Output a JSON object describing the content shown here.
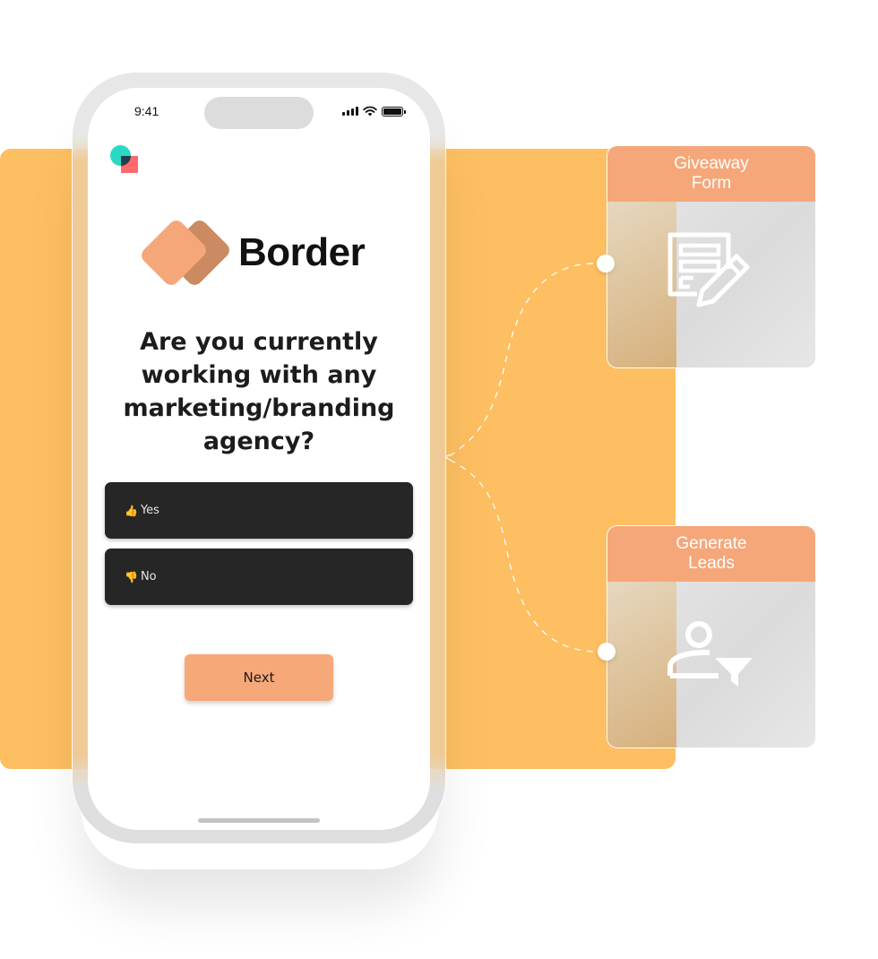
{
  "status_bar": {
    "time": "9:41"
  },
  "brand": {
    "name": "Border",
    "colors": {
      "front_card": "#f5a77a",
      "back_card": "#cb8a62"
    }
  },
  "question": {
    "text": "Are you currently working with any marketing/branding agency?"
  },
  "options": [
    {
      "emoji": "👍",
      "icon": "thumbs-up-icon",
      "label": "Yes"
    },
    {
      "emoji": "👎",
      "icon": "thumbs-down-icon",
      "label": "No"
    }
  ],
  "next_button": {
    "label": "Next"
  },
  "feature_cards": [
    {
      "title": "Giveaway\nForm",
      "icon": "form-edit-icon"
    },
    {
      "title": "Generate\nLeads",
      "icon": "user-filter-icon"
    }
  ],
  "colors": {
    "background_accent": "#fdbf61",
    "card_header": "#f5a77a",
    "option_bg": "#262626",
    "next_button_bg": "#f6a879"
  }
}
